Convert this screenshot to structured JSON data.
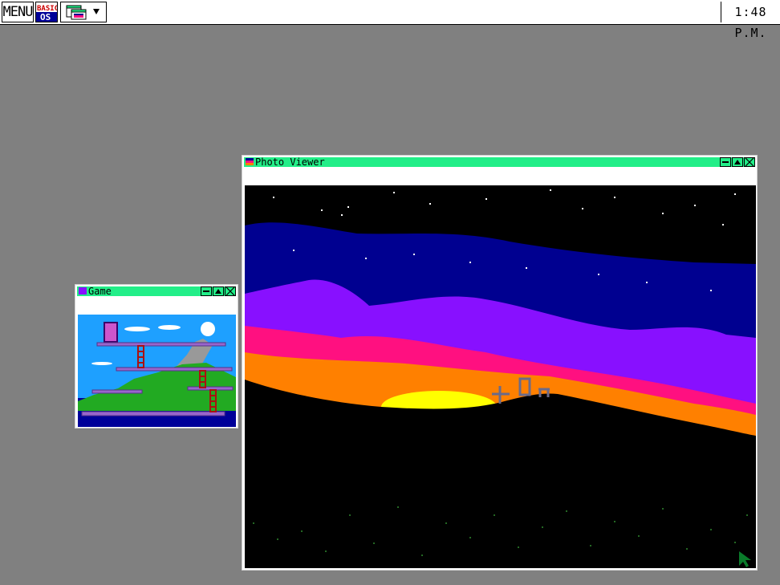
{
  "taskbar": {
    "menu_label": "MENU",
    "os_logo_text": [
      "BASIC",
      "OS"
    ],
    "clock": "1:48 P.M."
  },
  "windows": {
    "game": {
      "title": "Game"
    },
    "photo_viewer": {
      "title": "Photo Viewer"
    }
  },
  "colors": {
    "desktop": "#808080",
    "titlebar": "#22ee88",
    "sky_navy": "#000090",
    "sky_purple": "#8810ff",
    "sky_pink": "#ff1080",
    "sky_orange": "#ff8000",
    "sun": "#ffff00",
    "game_sky": "#1ea0ff",
    "game_platform": "#9966cc",
    "game_ladder": "#aa1111",
    "game_hill": "#22aa22",
    "game_water": "#000099"
  },
  "icons": [
    "menu-button",
    "os-logo",
    "task-list-icon",
    "minimize-icon",
    "maximize-icon",
    "close-icon"
  ]
}
